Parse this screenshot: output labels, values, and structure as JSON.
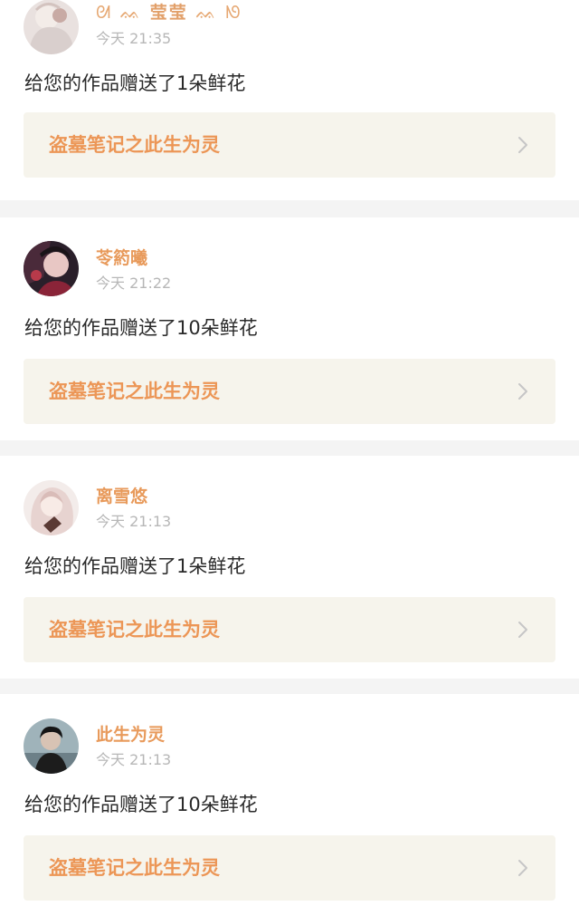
{
  "colors": {
    "page_background": "#f4f4f4",
    "card_background": "#ffffff",
    "username": "#e89a5b",
    "timestamp": "#b7b7b7",
    "message_text": "#2a2a2a",
    "work_link_background": "#f6f4ec",
    "work_title": "#ec9656",
    "chevron": "#c6c6c6"
  },
  "icons": {
    "chevron": "chevron-right-icon",
    "avatar": "avatar"
  },
  "gifts": [
    {
      "user": {
        "name": "莹莹",
        "name_prefix_ornament": "ᘛ",
        "name_left_ornament": "ᨐ",
        "name_center_ornament": "⍏",
        "name_right_ornament": "ᨐ",
        "name_suffix_ornament": "ᘚ"
      },
      "time": "今天 21:35",
      "message": "给您的作品赠送了1朵鲜花",
      "work_title": "盗墓笔记之此生为灵"
    },
    {
      "user": {
        "name": "苓箹曦"
      },
      "time": "今天 21:22",
      "message": "给您的作品赠送了10朵鲜花",
      "work_title": "盗墓笔记之此生为灵"
    },
    {
      "user": {
        "name": "离雪悠"
      },
      "time": "今天 21:13",
      "message": "给您的作品赠送了1朵鲜花",
      "work_title": "盗墓笔记之此生为灵"
    },
    {
      "user": {
        "name": "此生为灵"
      },
      "time": "今天 21:13",
      "message": "给您的作品赠送了10朵鲜花",
      "work_title": "盗墓笔记之此生为灵"
    }
  ]
}
